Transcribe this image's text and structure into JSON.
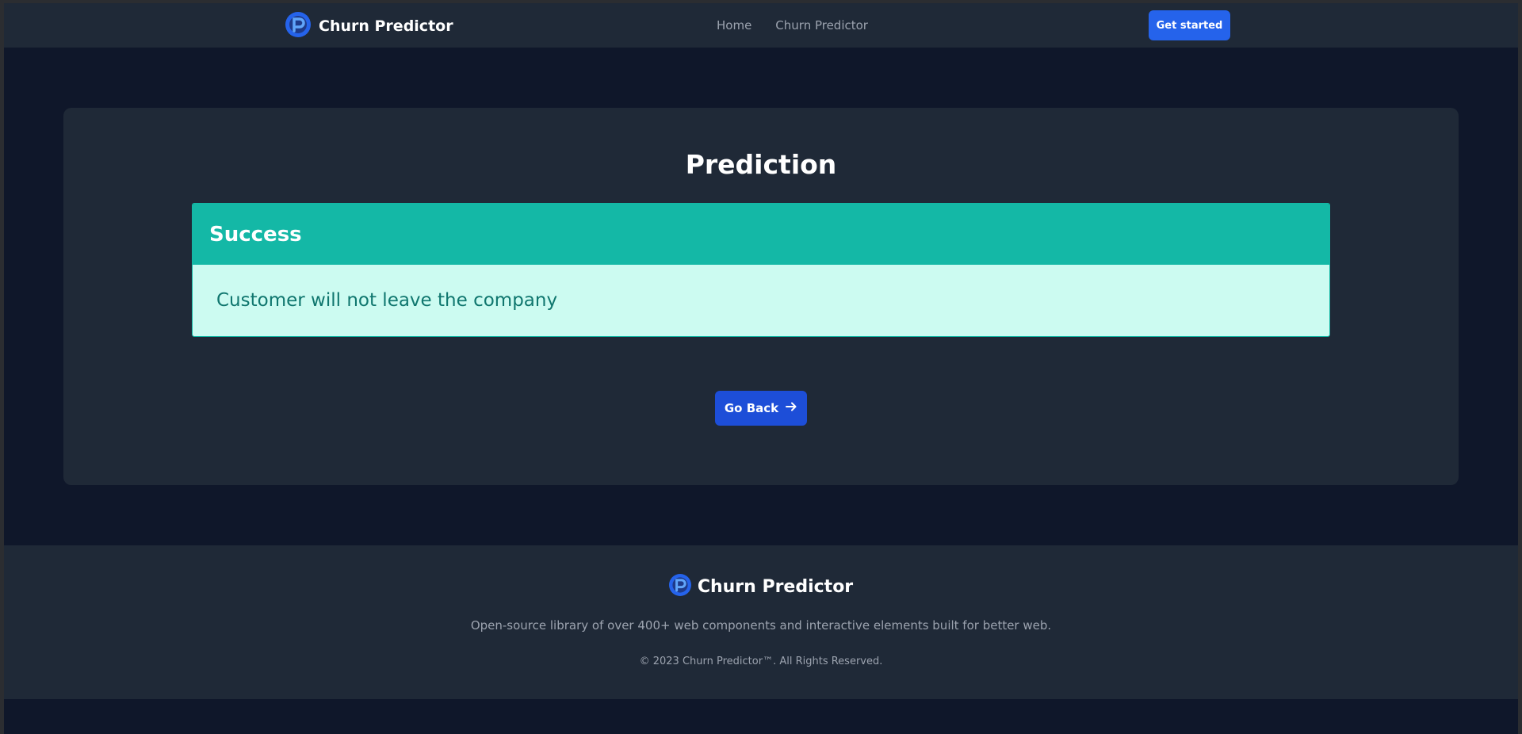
{
  "brand": {
    "name": "Churn Predictor",
    "logo_icon": "churn-logo-icon"
  },
  "nav": {
    "links": [
      "Home",
      "Churn Predictor"
    ],
    "cta_label": "Get started"
  },
  "main": {
    "title": "Prediction",
    "alert": {
      "heading": "Success",
      "message": "Customer will not leave the company"
    },
    "back_button": {
      "label": "Go Back",
      "icon": "arrow-right-icon"
    }
  },
  "footer": {
    "brand_name": "Churn Predictor",
    "description": "Open-source library of over 400+ web components and interactive elements built for better web.",
    "copyright": "© 2023 Churn Predictor™. All Rights Reserved."
  },
  "colors": {
    "background": "#0f172a",
    "surface": "#1f2937",
    "primary": "#2563eb",
    "success_accent": "#14b8a6",
    "success_bg": "#ccfbf1",
    "success_text": "#0f766e"
  }
}
